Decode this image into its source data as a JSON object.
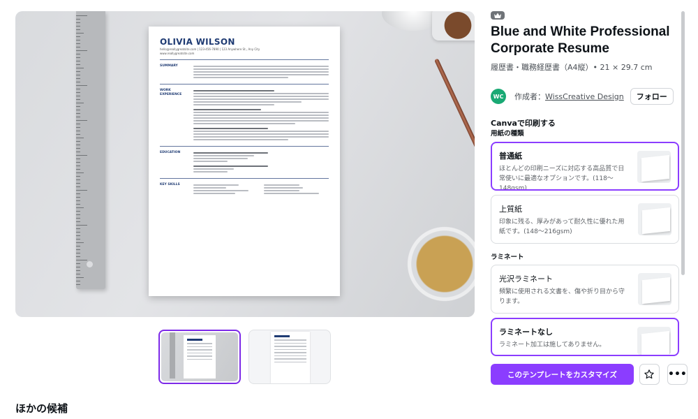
{
  "preview": {
    "resume": {
      "name": "OLIVIA WILSON",
      "contact": "hello@reallygreatsite.com | 123-456-7890 | 123 Anywhere St., Any City",
      "website": "www.reallygreatsite.com",
      "sections": [
        {
          "head": "SUMMARY"
        },
        {
          "head": "WORK EXPERIENCE"
        },
        {
          "head": "EDUCATION"
        },
        {
          "head": "KEY SKILLS"
        }
      ]
    }
  },
  "thumbnails": {
    "items": [
      {
        "label": "OLIVIA WILSON"
      },
      {
        "label": "OLIVIA WILSON"
      }
    ],
    "selected_index": 0
  },
  "product": {
    "badge_icon": "crown-icon",
    "title": "Blue and White Professional Corporate Resume",
    "meta": "履歴書・職務経歴書（A4縦）• 21 × 29.7 cm",
    "creator": {
      "avatar_text": "WC",
      "prefix": "作成者：",
      "name": "WissCreative Design",
      "follow_label": "フォロー"
    }
  },
  "print": {
    "heading": "Canvaで印刷する",
    "paper_label": "用紙の種類",
    "paper_options": [
      {
        "title": "普通紙",
        "desc": "ほとんどの印刷ニーズに対応する高品質で日常使いに最適なオプションです。(118〜148gsm)",
        "selected": true
      },
      {
        "title": "上質紙",
        "desc": "印象に残る、厚みがあって耐久性に優れた用紙です。(148〜216gsm)",
        "selected": false
      }
    ],
    "laminate_label": "ラミネート",
    "laminate_options": [
      {
        "title": "光沢ラミネート",
        "desc": "頻繁に使用される文書を、傷や折り目から守ります。",
        "selected": false
      },
      {
        "title": "ラミネートなし",
        "desc": "ラミネート加工は施してありません。",
        "selected": true
      }
    ]
  },
  "actions": {
    "customize_label": "このテンプレートをカスタマイズ",
    "star_icon": "star-icon",
    "more_icon": "more-icon",
    "more_glyph": "•••"
  },
  "other": {
    "heading": "ほかの候補"
  },
  "colors": {
    "accent": "#8b3dff",
    "resume_blue": "#1f3b73",
    "creator_avatar": "#19a974"
  }
}
